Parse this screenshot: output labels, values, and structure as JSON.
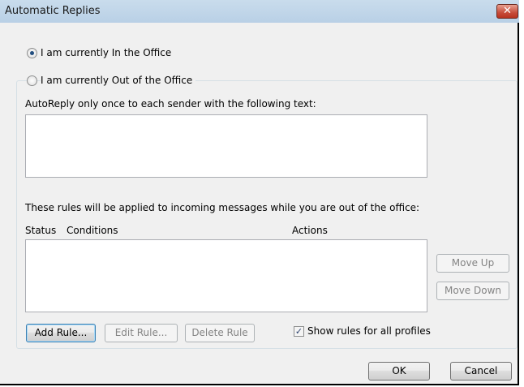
{
  "window": {
    "title": "Automatic Replies",
    "close_glyph": "✕"
  },
  "status": {
    "in_office_label": "I am currently In the Office",
    "out_office_label": "I am currently Out of the Office",
    "selected": "in_office"
  },
  "autoreply": {
    "label": "AutoReply only once to each sender with the following text:",
    "value": ""
  },
  "rules": {
    "intro": "These rules will be applied to incoming messages while you are out of the office:",
    "columns": [
      "Status",
      "Conditions",
      "Actions"
    ],
    "rows": [],
    "move_up_label": "Move Up",
    "move_down_label": "Move Down",
    "add_rule_label": "Add Rule...",
    "edit_rule_label": "Edit Rule...",
    "delete_rule_label": "Delete Rule",
    "show_all_profiles_label": "Show rules for all profiles",
    "show_all_profiles_checked": true,
    "check_glyph": "✓"
  },
  "footer": {
    "ok_label": "OK",
    "cancel_label": "Cancel"
  },
  "colors": {
    "title_bar": "#bcd2e8",
    "close_button": "#c74c3a",
    "dialog_bg": "#f0f0f0"
  }
}
